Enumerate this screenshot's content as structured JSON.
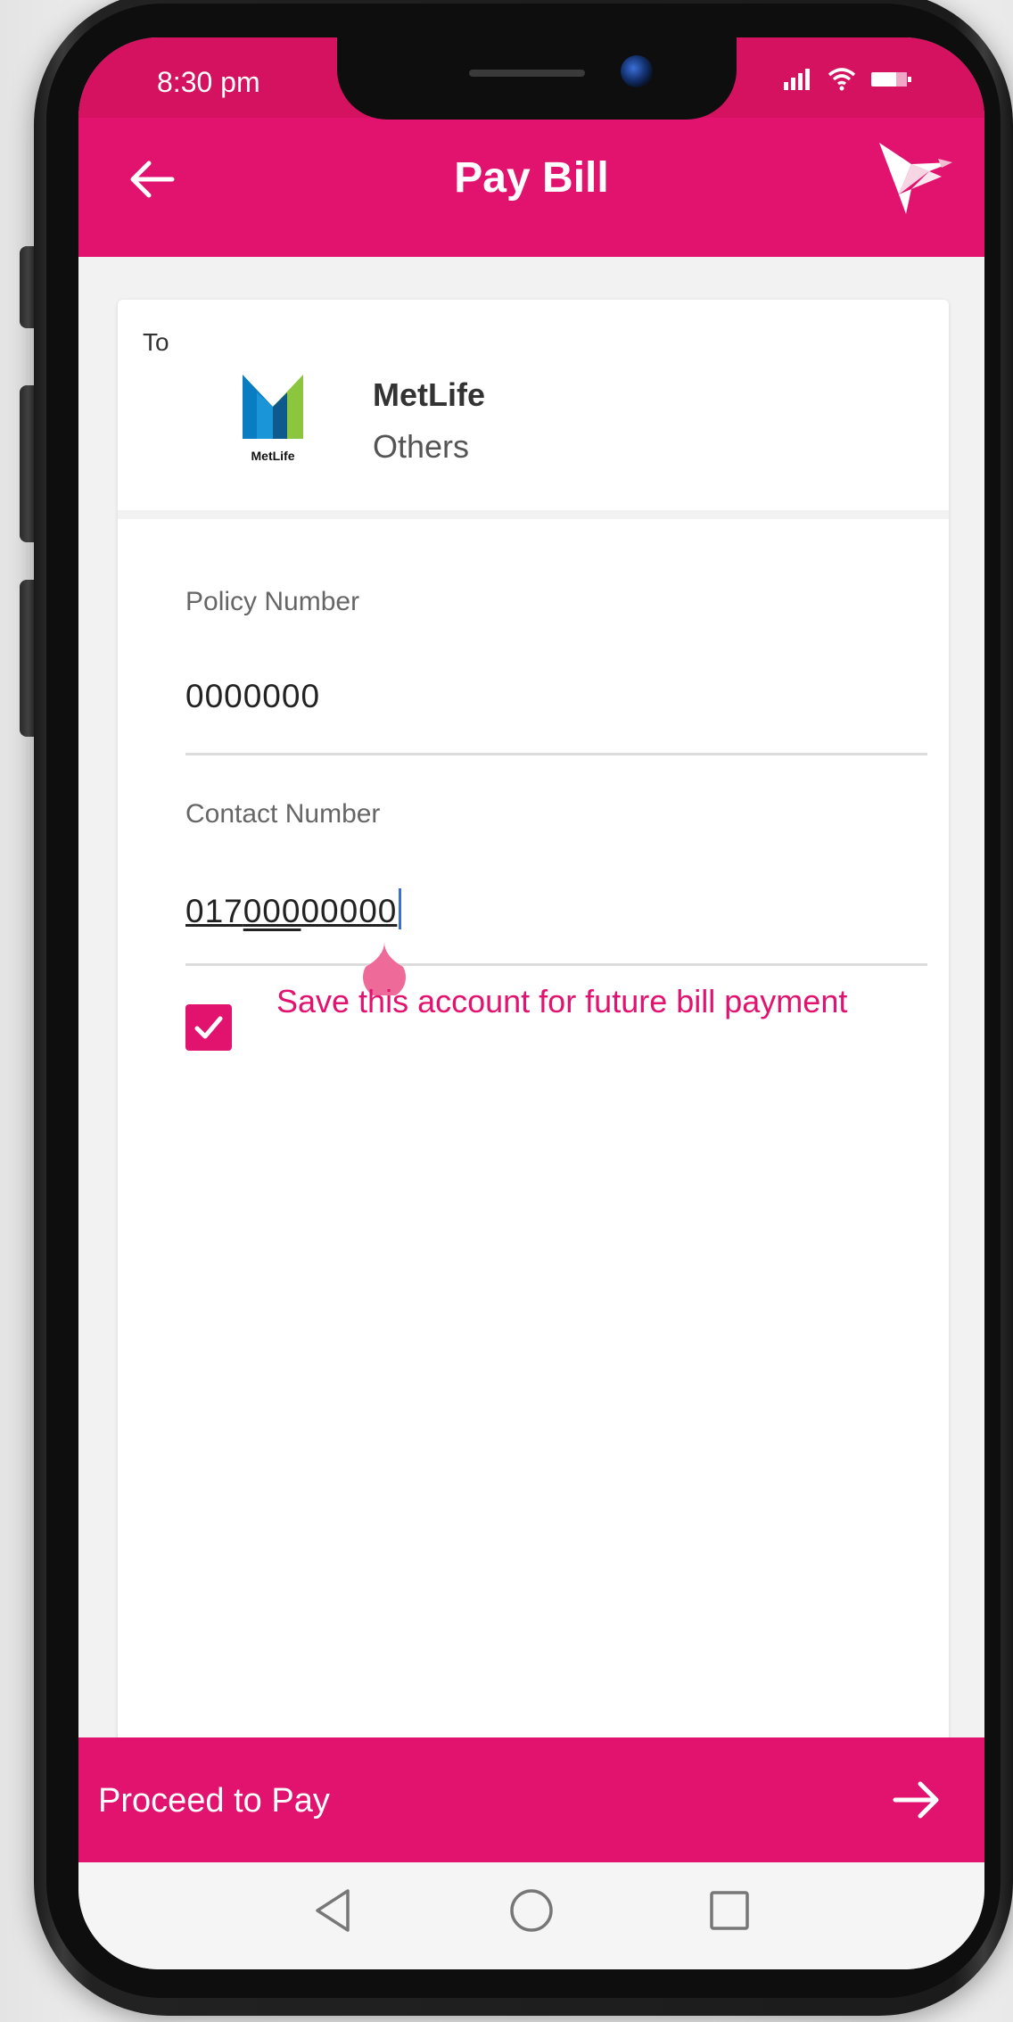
{
  "status_bar": {
    "time": "8:30 pm",
    "icons": [
      "signal-icon",
      "wifi-icon",
      "battery-icon"
    ]
  },
  "app_bar": {
    "title": "Pay Bill",
    "back_icon": "arrow-left-icon",
    "brand_icon": "bird-logo-icon"
  },
  "recipient": {
    "to_label": "To",
    "logo_text": "MetLife",
    "name": "MetLife",
    "category": "Others"
  },
  "form": {
    "policy": {
      "label": "Policy Number",
      "value": "0000000"
    },
    "contact": {
      "label": "Contact Number",
      "value_part1": "017",
      "value_part2": "000",
      "value_part3": "00000"
    },
    "save_account": {
      "checked": true,
      "label": "Save this account for future bill payment"
    }
  },
  "footer": {
    "proceed_label": "Proceed to Pay",
    "proceed_icon": "arrow-right-icon"
  },
  "nav": [
    "back-triangle-icon",
    "home-circle-icon",
    "recents-square-icon"
  ],
  "colors": {
    "accent": "#e2136e",
    "caret": "#3d6fd6",
    "metlife_blue": "#0a7cc1",
    "metlife_green": "#8cc63e"
  }
}
